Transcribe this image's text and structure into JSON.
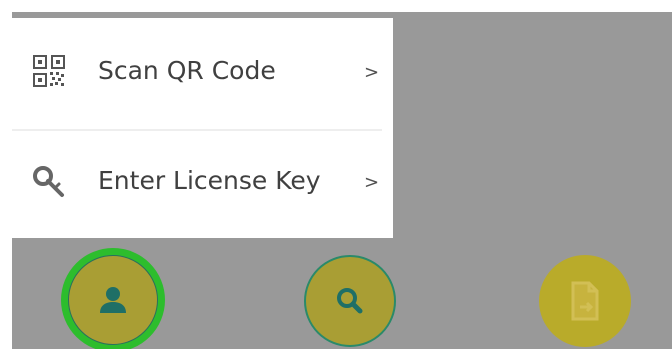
{
  "menu": {
    "items": [
      {
        "label": "Scan QR Code",
        "chevron": ">",
        "icon": "qr-code-icon"
      },
      {
        "label": "Enter License Key",
        "chevron": ">",
        "icon": "key-icon"
      }
    ]
  },
  "bottom_nav": {
    "buttons": [
      {
        "icon": "person-icon",
        "selected": true
      },
      {
        "icon": "search-icon",
        "selected": false
      },
      {
        "icon": "document-icon",
        "selected": false
      }
    ]
  },
  "colors": {
    "overlay": "#999999",
    "menu_background": "#ffffff",
    "nav_button": "#a99e34",
    "nav_selected_ring": "#2dbd2d",
    "icon_teal": "#1f6f66",
    "text": "#404040"
  }
}
